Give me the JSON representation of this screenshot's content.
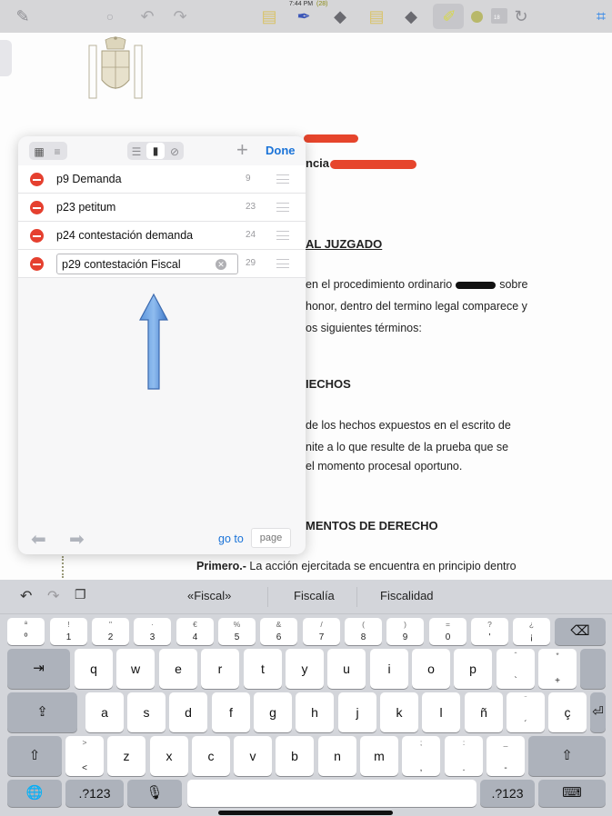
{
  "status": {
    "time": "7:44 PM",
    "battery": "(28)"
  },
  "toolbar": {
    "icons": [
      "lasso-icon",
      "color-dot-icon",
      "undo-icon",
      "redo-icon",
      "note-icon",
      "pen-icon",
      "eraser-icon",
      "note-icon",
      "eraser-icon",
      "highlighter-icon",
      "circle-icon",
      "line-size-icon",
      "refresh-icon",
      "crop-icon"
    ],
    "size_label": "18"
  },
  "document": {
    "lines": [
      {
        "text": "ncia",
        "bold": true
      },
      {
        "text": "AL JUZGADO",
        "bold": true,
        "underline": true
      },
      {
        "text": "en el procedimiento ordinario",
        "after": "sobre"
      },
      {
        "text": "honor, dentro del termino legal comparece y"
      },
      {
        "text": "os siguientes términos:"
      },
      {
        "text": "IECHOS",
        "bold": true
      },
      {
        "text": "de los hechos expuestos en el escrito de"
      },
      {
        "text": "nite a lo que resulte de la prueba que se"
      },
      {
        "text": "el momento procesal oportuno."
      },
      {
        "text": "MENTOS DE DERECHO",
        "bold": true
      },
      {
        "text": "Primero.-",
        "rest": " La acción ejercitada se encuentra en principio dentro"
      }
    ]
  },
  "bookmarks_panel": {
    "plus": "+",
    "done_label": "Done",
    "items": [
      {
        "label": "p9 Demanda",
        "page": "9"
      },
      {
        "label": "p23 petitum",
        "page": "23"
      },
      {
        "label": "p24 contestación demanda",
        "page": "24"
      }
    ],
    "editing": {
      "value": "p29 contestación Fiscal",
      "page": "29"
    },
    "goto_label": "go to",
    "page_placeholder": "page"
  },
  "keyboard": {
    "predictions": [
      "«Fiscal»",
      "Fiscalía",
      "Fiscalidad"
    ],
    "row1": [
      {
        "top": "ª",
        "bottom": "º"
      },
      {
        "top": "!",
        "bottom": "1"
      },
      {
        "top": "\"",
        "bottom": "2"
      },
      {
        "top": "·",
        "bottom": "3"
      },
      {
        "top": "€",
        "bottom": "4"
      },
      {
        "top": "%",
        "bottom": "5"
      },
      {
        "top": "&",
        "bottom": "6"
      },
      {
        "top": "/",
        "bottom": "7"
      },
      {
        "top": "(",
        "bottom": "8"
      },
      {
        "top": ")",
        "bottom": "9"
      },
      {
        "top": "=",
        "bottom": "0"
      },
      {
        "top": "?",
        "bottom": "'"
      },
      {
        "top": "¿",
        "bottom": "¡"
      }
    ],
    "row2": [
      "q",
      "w",
      "e",
      "r",
      "t",
      "y",
      "u",
      "i",
      "o",
      "p"
    ],
    "row2_extra": [
      {
        "top": "ˆ",
        "bottom": "`"
      },
      {
        "top": "*",
        "bottom": "+"
      }
    ],
    "row3": [
      "a",
      "s",
      "d",
      "f",
      "g",
      "h",
      "j",
      "k",
      "l",
      "ñ"
    ],
    "row3_extra": [
      {
        "top": "¨",
        "bottom": "´"
      },
      {
        "top": "",
        "bottom": "ç"
      }
    ],
    "row4_special": {
      "top": ">",
      "bottom": "<"
    },
    "row4": [
      "z",
      "x",
      "c",
      "v",
      "b",
      "n",
      "m"
    ],
    "row4_extra": [
      {
        "top": ";",
        "bottom": ","
      },
      {
        "top": ":",
        "bottom": "."
      },
      {
        "top": "_",
        "bottom": "-"
      }
    ],
    "numbers_label": ".?123",
    "numbers_label_right": ".?123"
  }
}
